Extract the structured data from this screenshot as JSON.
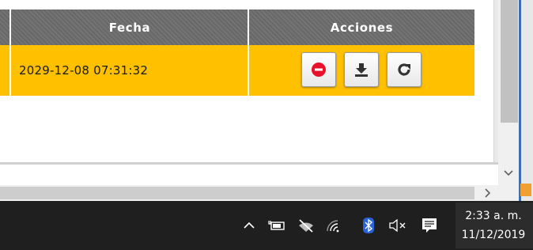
{
  "table": {
    "headers": {
      "fecha": "Fecha",
      "acciones": "Acciones"
    },
    "rows": [
      {
        "fecha": "2029-12-08 07:31:32",
        "actions": [
          {
            "icon": "stop-icon",
            "color": "#e8102b"
          },
          {
            "icon": "download-icon",
            "color": "#333333"
          },
          {
            "icon": "refresh-icon",
            "color": "#333333"
          }
        ]
      }
    ],
    "colors": {
      "header_bg": "#6d6d6d",
      "row_highlight": "#ffc000"
    }
  },
  "taskbar": {
    "tray_icons": [
      "chevron-up-icon",
      "battery-icon",
      "network-off-icon",
      "wifi-icon",
      "bluetooth-icon",
      "volume-muted-icon",
      "notification-icon"
    ],
    "clock": {
      "time": "2:33 a. m.",
      "date": "11/12/2019"
    }
  }
}
